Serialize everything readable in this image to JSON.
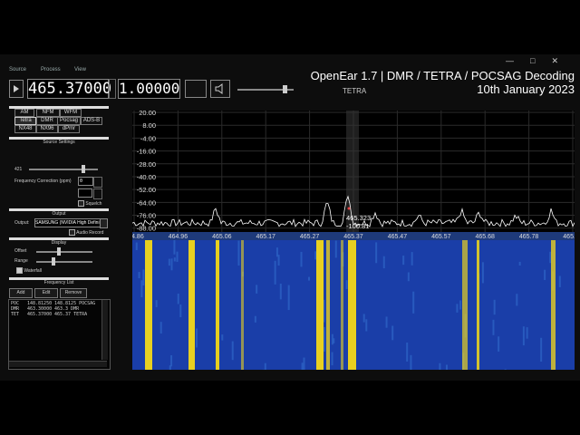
{
  "window": {
    "controls": [
      "—",
      "□",
      "✕"
    ]
  },
  "menu": [
    "Source",
    "Process",
    "View"
  ],
  "toolbar": {
    "frequency": "465.37000",
    "gain": "1.00000"
  },
  "overlay": {
    "line1": "OpenEar 1.7 | DMR / TETRA / POCSAG Decoding",
    "line2": "10th January 2023",
    "mode_label": "TETRA"
  },
  "modes": [
    "AM",
    "NFM",
    "WFM",
    "Tetra",
    "DMR",
    "Pocsag",
    "ADS-B",
    "NX48",
    "NX96",
    "dPmr"
  ],
  "active_mode": "Tetra",
  "source_settings": {
    "title": "Source Settings",
    "slider_value": "421",
    "freq_corr_label": "Frequency Correction (ppm)",
    "freq_corr_value": "0",
    "second_value": "",
    "squelch_label": "Squelch"
  },
  "output": {
    "title": "Output",
    "output_label": "Output:",
    "device": "SAMSUNG (NVIDIA High Defini",
    "audio_record_label": "Audio Record"
  },
  "display": {
    "title": "Display",
    "offset_label": "Offset",
    "range_label": "Range",
    "waterfall_label": "Waterfall"
  },
  "freq_list": {
    "title": "Frequency List",
    "buttons": [
      "Add",
      "Edit",
      "Remove"
    ],
    "rows": [
      [
        "POC",
        "148.81250",
        "148.8125 POCSAG"
      ],
      [
        "DMR",
        "463.30000",
        "463.3 DMR"
      ],
      [
        "TET",
        "465.37000",
        "465.37 TETRA"
      ]
    ]
  },
  "spectrum": {
    "y_ticks": [
      "20.00",
      "8.00",
      "-4.00",
      "-16.00",
      "-28.00",
      "-40.00",
      "-52.00",
      "-64.00",
      "-76.00",
      "-88.00"
    ],
    "x_ticks": [
      "464.86",
      "464.96",
      "465.06",
      "465.17",
      "465.27",
      "465.37",
      "465.47",
      "465.57",
      "465.68",
      "465.78",
      "465.88"
    ],
    "cursor_freq": "465.323",
    "cursor_level": "-100.81"
  },
  "colors": {
    "waterfall_bg": "#1a3ea8",
    "signal": "#e8d020",
    "trace": "#ffffff"
  }
}
